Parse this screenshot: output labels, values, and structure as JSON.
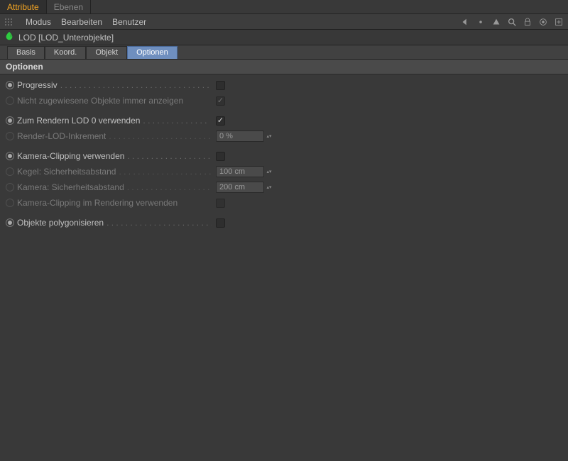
{
  "top_tabs": {
    "attribute": "Attribute",
    "ebenen": "Ebenen"
  },
  "menu": {
    "modus": "Modus",
    "bearbeiten": "Bearbeiten",
    "benutzer": "Benutzer"
  },
  "object": {
    "title": "LOD [LOD_Unterobjekte]"
  },
  "sub_tabs": {
    "basis": "Basis",
    "koord": "Koord.",
    "objekt": "Objekt",
    "optionen": "Optionen"
  },
  "section": {
    "heading": "Optionen"
  },
  "params": {
    "progressiv": {
      "label": "Progressiv",
      "checked": false
    },
    "nicht_zugewiesene": {
      "label": "Nicht zugewiesene Objekte immer anzeigen",
      "checked": true
    },
    "zum_rendern_lod0": {
      "label": "Zum Rendern LOD 0 verwenden",
      "checked": true
    },
    "render_lod_inkrement": {
      "label": "Render-LOD-Inkrement",
      "value": "0 %"
    },
    "kamera_clipping": {
      "label": "Kamera-Clipping verwenden",
      "checked": false
    },
    "kegel_sicherheit": {
      "label": "Kegel: Sicherheitsabstand",
      "value": "100 cm"
    },
    "kamera_sicherheit": {
      "label": "Kamera: Sicherheitsabstand",
      "value": "200 cm"
    },
    "kamera_clipping_rendering": {
      "label": "Kamera-Clipping im Rendering verwenden",
      "checked": false
    },
    "objekte_polygonisieren": {
      "label": "Objekte polygonisieren",
      "checked": false
    }
  }
}
